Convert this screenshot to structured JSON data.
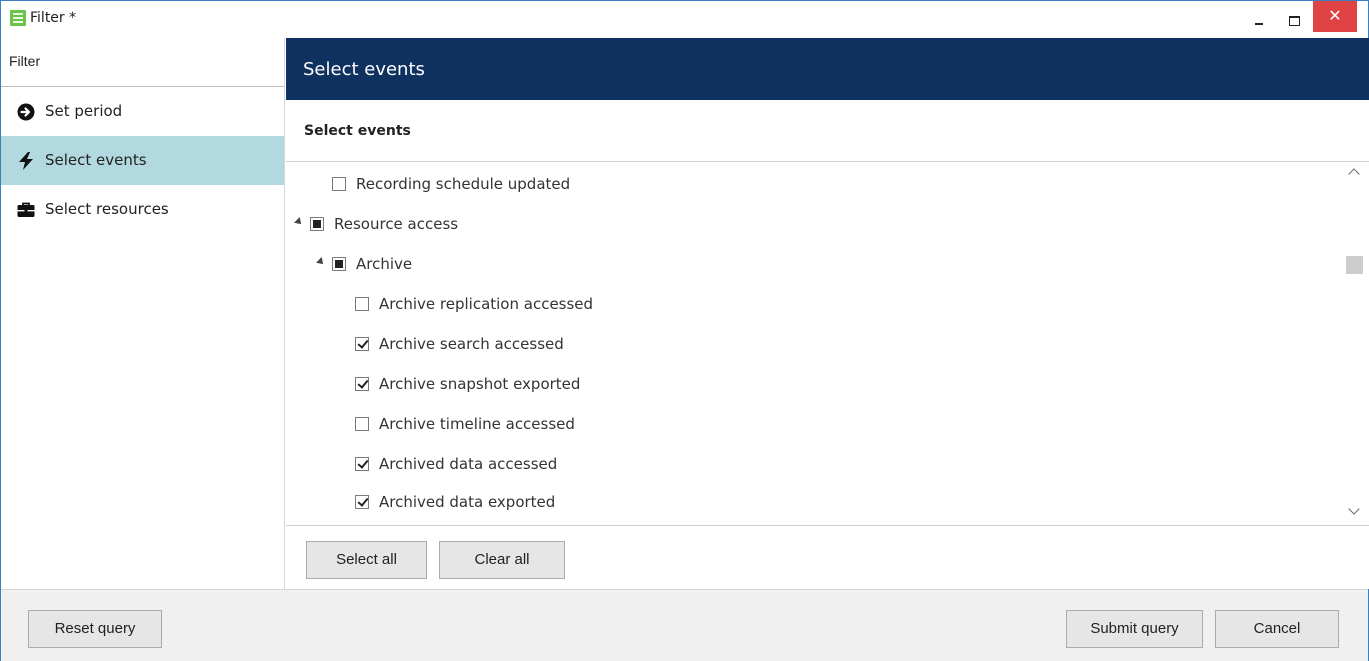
{
  "window": {
    "title": "Filter *"
  },
  "sidebar": {
    "header": "Filter",
    "items": [
      {
        "label": "Set period",
        "icon": "arrow-circle-right-icon",
        "active": false
      },
      {
        "label": "Select events",
        "icon": "lightning-icon",
        "active": true
      },
      {
        "label": "Select resources",
        "icon": "briefcase-icon",
        "active": false
      }
    ]
  },
  "main": {
    "header": "Select events",
    "section_title": "Select events",
    "tree": [
      {
        "label": "Recording schedule updated",
        "level": 2,
        "state": "unchecked",
        "expander": false
      },
      {
        "label": "Resource access",
        "level": 0,
        "state": "partial",
        "expander": true
      },
      {
        "label": "Archive",
        "level": 1,
        "state": "partial",
        "expander": true
      },
      {
        "label": "Archive replication accessed",
        "level": 2,
        "state": "unchecked",
        "expander": false
      },
      {
        "label": "Archive search accessed",
        "level": 2,
        "state": "checked",
        "expander": false
      },
      {
        "label": "Archive snapshot exported",
        "level": 2,
        "state": "checked",
        "expander": false
      },
      {
        "label": "Archive timeline accessed",
        "level": 2,
        "state": "unchecked",
        "expander": false
      },
      {
        "label": "Archived data accessed",
        "level": 2,
        "state": "checked",
        "expander": false
      },
      {
        "label": "Archived data exported",
        "level": 2,
        "state": "checked",
        "expander": false
      }
    ],
    "select_all_label": "Select all",
    "clear_all_label": "Clear all"
  },
  "footer": {
    "reset_label": "Reset query",
    "submit_label": "Submit query",
    "cancel_label": "Cancel"
  },
  "colors": {
    "header_bg": "#0f3160",
    "active_item_bg": "#b2d9df",
    "close_button_bg": "#e04343",
    "app_icon": "#6dc24b"
  }
}
